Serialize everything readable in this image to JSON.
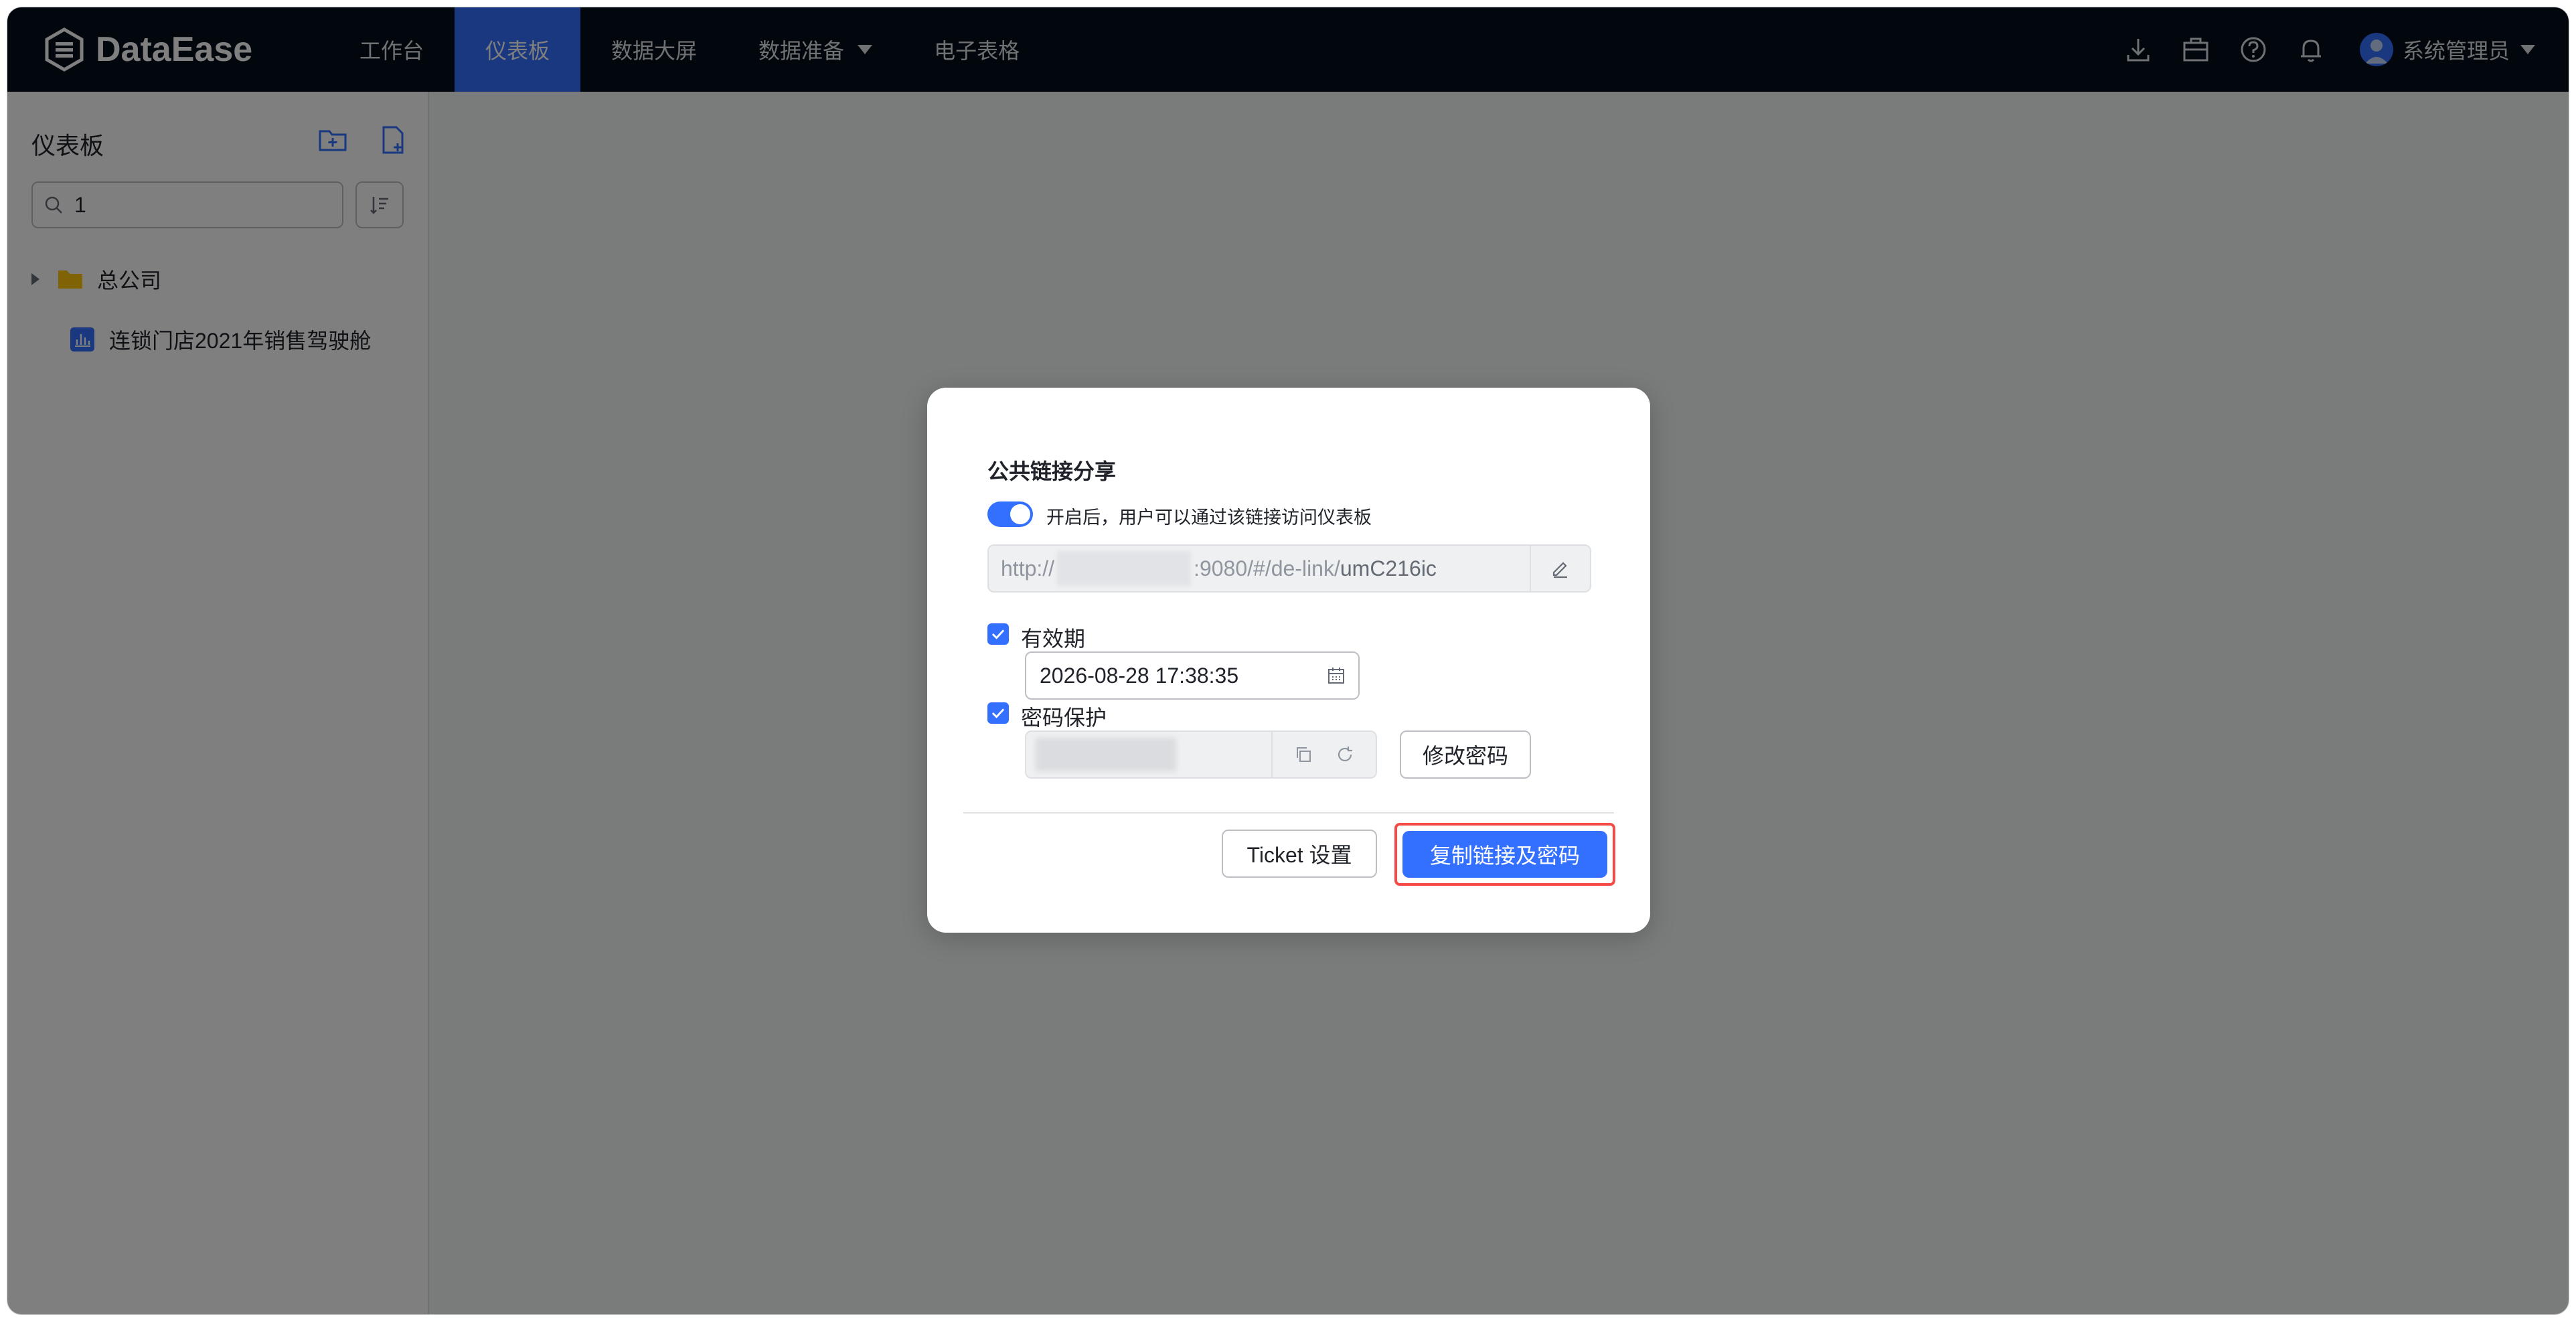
{
  "app": {
    "logo_text": "DataEase"
  },
  "nav": {
    "items": [
      {
        "label": "工作台"
      },
      {
        "label": "仪表板"
      },
      {
        "label": "数据大屏"
      },
      {
        "label": "数据准备"
      },
      {
        "label": "电子表格"
      }
    ],
    "active_index": 1
  },
  "header": {
    "icons": [
      "download-icon",
      "toolbox-icon",
      "help-icon",
      "bell-icon"
    ],
    "user_name": "系统管理员"
  },
  "sidebar": {
    "title": "仪表板",
    "search_value": "1",
    "tree": [
      {
        "label": "总公司",
        "type": "folder",
        "expandable": true
      },
      {
        "label": "连锁门店2021年销售驾驶舱",
        "type": "dashboard",
        "expandable": false
      }
    ]
  },
  "dialog": {
    "title": "公共链接分享",
    "toggle_on": true,
    "toggle_label": "开启后，用户可以通过该链接访问仪表板",
    "link": {
      "prefix": "http://",
      "middle": ":9080/#/de-link/",
      "suffix": "umC216ic"
    },
    "expiry": {
      "checked": true,
      "label": "有效期",
      "value": "2026-08-28 17:38:35"
    },
    "password": {
      "checked": true,
      "label": "密码保护",
      "change_label": "修改密码"
    },
    "buttons": {
      "ticket_label": "Ticket 设置",
      "copy_label": "复制链接及密码"
    }
  },
  "colors": {
    "accent": "#3370ff",
    "topbar": "#050e1a",
    "folder": "#ffc60a",
    "highlight": "#f54a45"
  }
}
